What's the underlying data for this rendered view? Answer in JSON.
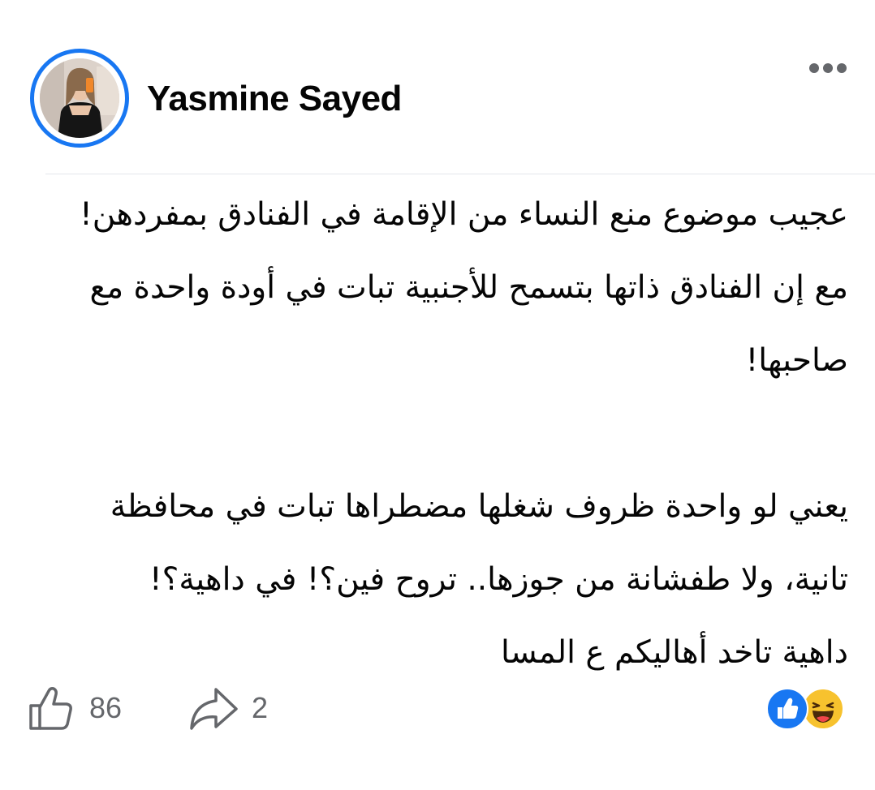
{
  "post": {
    "author": {
      "name": "Yasmine Sayed",
      "avatar_icon": "profile-photo"
    },
    "menu_icon": "more-options-icon",
    "text": {
      "line1": "عجيب موضوع منع النساء من الإقامة في الفنادق بمفردهن!",
      "line2": "مع إن الفنادق ذاتها بتسمح للأجنبية تبات في أودة واحدة مع",
      "line3": "صاحبها!",
      "line4": "يعني لو واحدة ظروف شغلها مضطراها تبات في محافظة",
      "line5": "تانية، ولا طفشانة من جوزها.. تروح فين؟! في داهية؟!",
      "line6": "داهية تاخد أهاليكم ع المسا"
    },
    "actions": {
      "like_icon": "thumbs-up-outline-icon",
      "like_count": "86",
      "share_icon": "share-arrow-icon",
      "share_count": "2"
    },
    "reactions": [
      "like-reaction-icon",
      "haha-reaction-icon"
    ],
    "colors": {
      "accent": "#1877f2",
      "text": "#050505",
      "muted": "#65676b",
      "haha": "#f7c22e"
    }
  }
}
